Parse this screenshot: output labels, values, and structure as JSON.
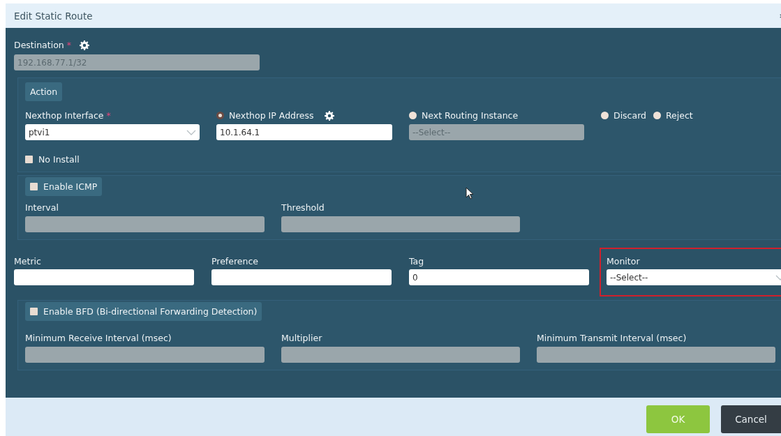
{
  "dialog": {
    "title": "Edit Static Route"
  },
  "destination": {
    "label": "Destination",
    "required_mark": "*",
    "has_settings": true,
    "value": "192.168.77.1/32",
    "disabled": true
  },
  "action": {
    "legend": "Action",
    "nexthop_interface": {
      "label": "Nexthop Interface",
      "required_mark": "*",
      "value": "ptvi1"
    },
    "options": [
      {
        "label": "Nexthop IP Address",
        "selected": true,
        "kind": "input",
        "has_settings": true,
        "value": "10.1.64.1",
        "disabled": false
      },
      {
        "label": "Next Routing Instance",
        "selected": false,
        "kind": "select",
        "has_settings": false,
        "value": "--Select--",
        "disabled": true
      },
      {
        "label": "Discard",
        "selected": false,
        "kind": "plain"
      },
      {
        "label": "Reject",
        "selected": false,
        "kind": "plain"
      }
    ],
    "no_install": {
      "label": "No Install",
      "checked": false
    }
  },
  "icmp": {
    "label": "Enable ICMP",
    "checked": false,
    "fields": [
      {
        "label": "Interval",
        "disabled": true
      },
      {
        "label": "Threshold",
        "disabled": true
      }
    ]
  },
  "route_fields": [
    {
      "label": "Metric",
      "kind": "input",
      "highlighted": false
    },
    {
      "label": "Preference",
      "kind": "input",
      "highlighted": false
    },
    {
      "label": "Tag",
      "kind": "input",
      "value": "0",
      "highlighted": false
    },
    {
      "label": "Monitor",
      "kind": "select",
      "value": "--Select--",
      "highlighted": true
    }
  ],
  "bfd": {
    "label": "Enable BFD (Bi-directional Forwarding Detection)",
    "checked": false,
    "fields": [
      {
        "label": "Minimum Receive Interval (msec)",
        "disabled": true
      },
      {
        "label": "Multiplier",
        "disabled": true
      },
      {
        "label": "Minimum Transmit Interval (msec)",
        "disabled": true
      }
    ]
  },
  "buttons": [
    {
      "label": "OK",
      "kind": "primary"
    },
    {
      "label": "Cancel",
      "kind": "secondary"
    }
  ]
}
